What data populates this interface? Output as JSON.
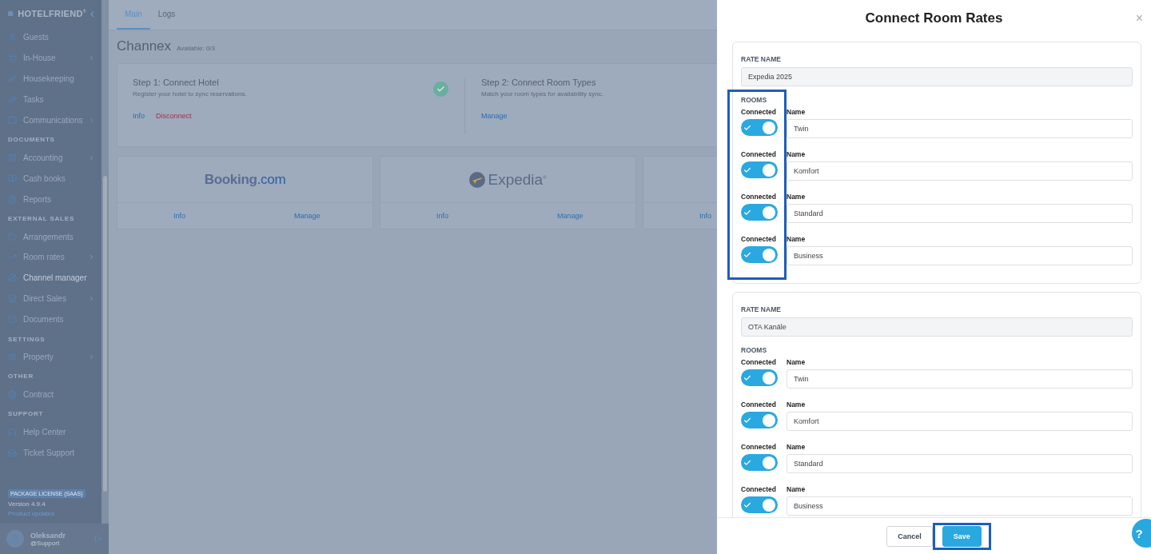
{
  "sidebar": {
    "brand": "HOTELFRIEND",
    "brand_mark": "®",
    "collapse_icon": "‹",
    "sections": [
      {
        "items": [
          {
            "label": "Guests",
            "submenu": false,
            "selected": false
          },
          {
            "label": "In-House",
            "submenu": true,
            "selected": false
          },
          {
            "label": "Housekeeping",
            "submenu": false,
            "selected": false
          },
          {
            "label": "Tasks",
            "submenu": false,
            "selected": false
          },
          {
            "label": "Communications",
            "submenu": true,
            "selected": false
          }
        ]
      },
      {
        "header": "DOCUMENTS",
        "items": [
          {
            "label": "Accounting",
            "submenu": true,
            "selected": false
          },
          {
            "label": "Cash books",
            "submenu": false,
            "selected": false
          },
          {
            "label": "Reports",
            "submenu": false,
            "selected": false
          }
        ]
      },
      {
        "header": "EXTERNAL SALES",
        "items": [
          {
            "label": "Arrangements",
            "submenu": false,
            "selected": false
          },
          {
            "label": "Room rates",
            "submenu": true,
            "selected": false
          },
          {
            "label": "Channel manager",
            "submenu": false,
            "selected": true
          },
          {
            "label": "Direct Sales",
            "submenu": true,
            "selected": false
          },
          {
            "label": "Documents",
            "submenu": false,
            "selected": false
          }
        ]
      },
      {
        "header": "SETTINGS",
        "items": [
          {
            "label": "Property",
            "submenu": true,
            "selected": false
          }
        ]
      },
      {
        "header": "OTHER",
        "items": [
          {
            "label": "Contract",
            "submenu": false,
            "selected": false
          }
        ]
      },
      {
        "header": "SUPPORT",
        "items": [
          {
            "label": "Help Center",
            "submenu": false,
            "selected": false
          },
          {
            "label": "Ticket Support",
            "submenu": false,
            "selected": false
          }
        ]
      }
    ],
    "license": "PACKAGE LICENSE (SAAS)",
    "version": "Version 4.9.4",
    "updates_link": "Product updates",
    "user": {
      "name": "Oleksandr",
      "role": "@Support"
    }
  },
  "tabs": [
    {
      "label": "Main",
      "selected": true
    },
    {
      "label": "Logs",
      "selected": false
    }
  ],
  "page": {
    "title": "Channex",
    "available": "Available: 0/3"
  },
  "steps": [
    {
      "title": "Step 1: Connect Hotel",
      "description": "Register your hotel to sync reservations.",
      "done": true,
      "links": [
        {
          "label": "Info",
          "kind": "normal"
        },
        {
          "label": "Disconnect",
          "kind": "danger"
        }
      ]
    },
    {
      "title": "Step 2: Connect Room Types",
      "description": "Match your room types for availability sync.",
      "links": [
        {
          "label": "Manage",
          "kind": "normal"
        }
      ]
    }
  ],
  "channels": [
    {
      "logo": {
        "kind": "booking",
        "name": "Booking",
        "suffix": ".com"
      },
      "links": [
        "Info",
        "Manage"
      ]
    },
    {
      "logo": {
        "kind": "expedia",
        "name": "Expedia",
        "suffix": "®"
      },
      "links": [
        "Info",
        "Manage"
      ]
    },
    {
      "links": [
        "Info"
      ]
    }
  ],
  "drawer": {
    "title": "Connect Room Rates",
    "close": "×",
    "rates": [
      {
        "label": "RATE NAME",
        "name": "Expedia 2025",
        "rooms_label": "ROOMS",
        "highlighted": true,
        "rooms": [
          {
            "connected_label": "Connected",
            "connected": true,
            "name_label": "Name",
            "name": "Twin"
          },
          {
            "connected_label": "Connected",
            "connected": true,
            "name_label": "Name",
            "name": "Komfort"
          },
          {
            "connected_label": "Connected",
            "connected": true,
            "name_label": "Name",
            "name": "Standard"
          },
          {
            "connected_label": "Connected",
            "connected": true,
            "name_label": "Name",
            "name": "Business"
          }
        ]
      },
      {
        "label": "RATE NAME",
        "name": "OTA Kanäle",
        "rooms_label": "ROOMS",
        "highlighted": false,
        "rooms": [
          {
            "connected_label": "Connected",
            "connected": true,
            "name_label": "Name",
            "name": "Twin"
          },
          {
            "connected_label": "Connected",
            "connected": true,
            "name_label": "Name",
            "name": "Komfort"
          },
          {
            "connected_label": "Connected",
            "connected": true,
            "name_label": "Name",
            "name": "Standard"
          },
          {
            "connected_label": "Connected",
            "connected": true,
            "name_label": "Name",
            "name": "Business"
          }
        ]
      }
    ],
    "buttons": [
      {
        "label": "Cancel",
        "kind": "secondary",
        "highlighted": false
      },
      {
        "label": "Save",
        "kind": "primary",
        "highlighted": true
      }
    ]
  },
  "help_button": "?"
}
